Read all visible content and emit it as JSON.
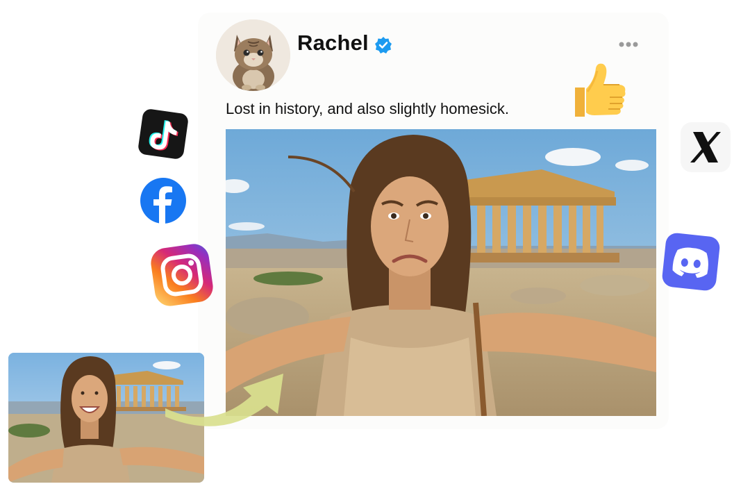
{
  "post": {
    "username": "Rachel",
    "caption": "Lost in history, and also slightly homesick."
  },
  "icons": {
    "avatar": "kitten-avatar",
    "verified": "verified-badge-icon",
    "more": "more-options-icon",
    "reaction": "thumbs-up-emoji",
    "socials": [
      "tiktok-icon",
      "facebook-icon",
      "instagram-icon",
      "x-icon",
      "discord-icon"
    ],
    "transform": "curved-arrow-icon"
  },
  "colors": {
    "verified": "#1d9bf0",
    "facebook": "#1877f2",
    "discord": "#5865f2",
    "tiktok": "#161616",
    "arrow": "#d9df8e"
  }
}
